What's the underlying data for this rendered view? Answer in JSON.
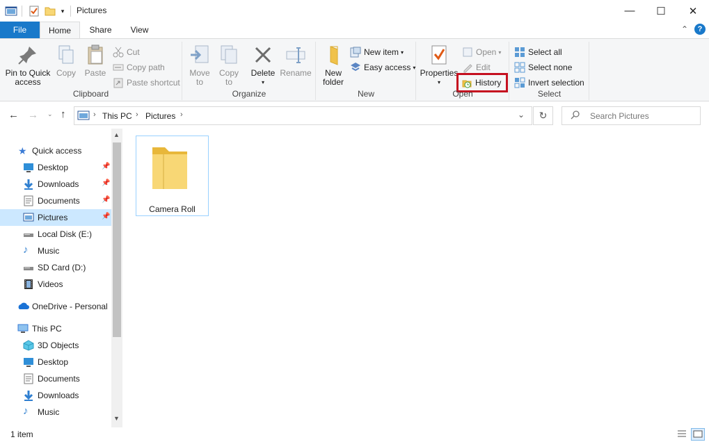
{
  "window": {
    "title": "Pictures",
    "minimize_glyph": "—",
    "maximize_glyph": "☐",
    "close_glyph": "✕"
  },
  "tabs": {
    "file": "File",
    "home": "Home",
    "share": "Share",
    "view": "View"
  },
  "ribbon": {
    "clipboard": {
      "label": "Clipboard",
      "pin_line1": "Pin to Quick",
      "pin_line2": "access",
      "copy": "Copy",
      "paste": "Paste",
      "cut": "Cut",
      "copy_path": "Copy path",
      "paste_shortcut": "Paste shortcut"
    },
    "organize": {
      "label": "Organize",
      "move_to_line1": "Move",
      "move_to_line2": "to",
      "copy_to_line1": "Copy",
      "copy_to_line2": "to",
      "delete": "Delete",
      "rename": "Rename"
    },
    "new": {
      "label": "New",
      "new_folder_line1": "New",
      "new_folder_line2": "folder",
      "new_item": "New item",
      "easy_access": "Easy access"
    },
    "open": {
      "label": "Open",
      "properties": "Properties",
      "open": "Open",
      "edit": "Edit",
      "history": "History"
    },
    "select": {
      "label": "Select",
      "select_all": "Select all",
      "select_none": "Select none",
      "invert_selection": "Invert selection"
    }
  },
  "address": {
    "crumbs": [
      "This PC",
      "Pictures"
    ],
    "search_placeholder": "Search Pictures"
  },
  "nav": {
    "quick_access": "Quick access",
    "quick_items": [
      "Desktop",
      "Downloads",
      "Documents",
      "Pictures",
      "Local Disk (E:)",
      "Music",
      "SD Card (D:)",
      "Videos"
    ],
    "onedrive": "OneDrive - Personal",
    "this_pc": "This PC",
    "pc_items": [
      "3D Objects",
      "Desktop",
      "Documents",
      "Downloads",
      "Music"
    ]
  },
  "content": {
    "items": [
      {
        "name": "Camera Roll"
      }
    ]
  },
  "status": {
    "count": "1 item"
  },
  "colors": {
    "accent": "#1979ca",
    "highlight_box": "#c50f1f",
    "selected_nav": "#cce8ff",
    "folder_yellow": "#f8d775"
  }
}
